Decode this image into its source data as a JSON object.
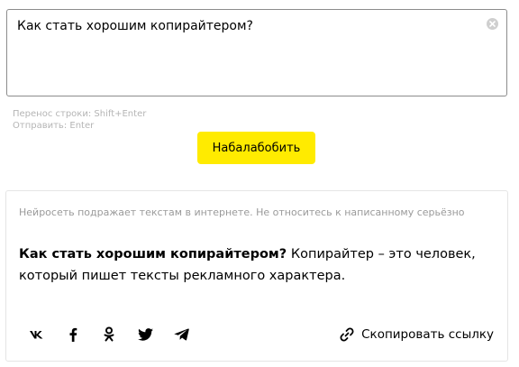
{
  "query": {
    "value": "Как стать хорошим копирайтером?",
    "clear_icon": "close-circle-icon"
  },
  "hints": {
    "line_break": "Перенос строки: Shift+Enter",
    "send": "Отправить: Enter"
  },
  "submit_button": {
    "label": "Набалабобить",
    "color": "#ffeb00"
  },
  "result": {
    "disclaimer": "Нейросеть подражает текстам в интернете. Не относитесь к написанному серьёзно",
    "question": "Как стать хорошим копирайтером?",
    "answer": "Копирайтер – это человек, который пишет тексты рекламного характера."
  },
  "share": {
    "icons": [
      "vk-icon",
      "facebook-icon",
      "odnoklassniki-icon",
      "twitter-icon",
      "telegram-icon"
    ],
    "copy_link_label": "Скопировать ссылку",
    "copy_link_icon": "link-icon"
  }
}
